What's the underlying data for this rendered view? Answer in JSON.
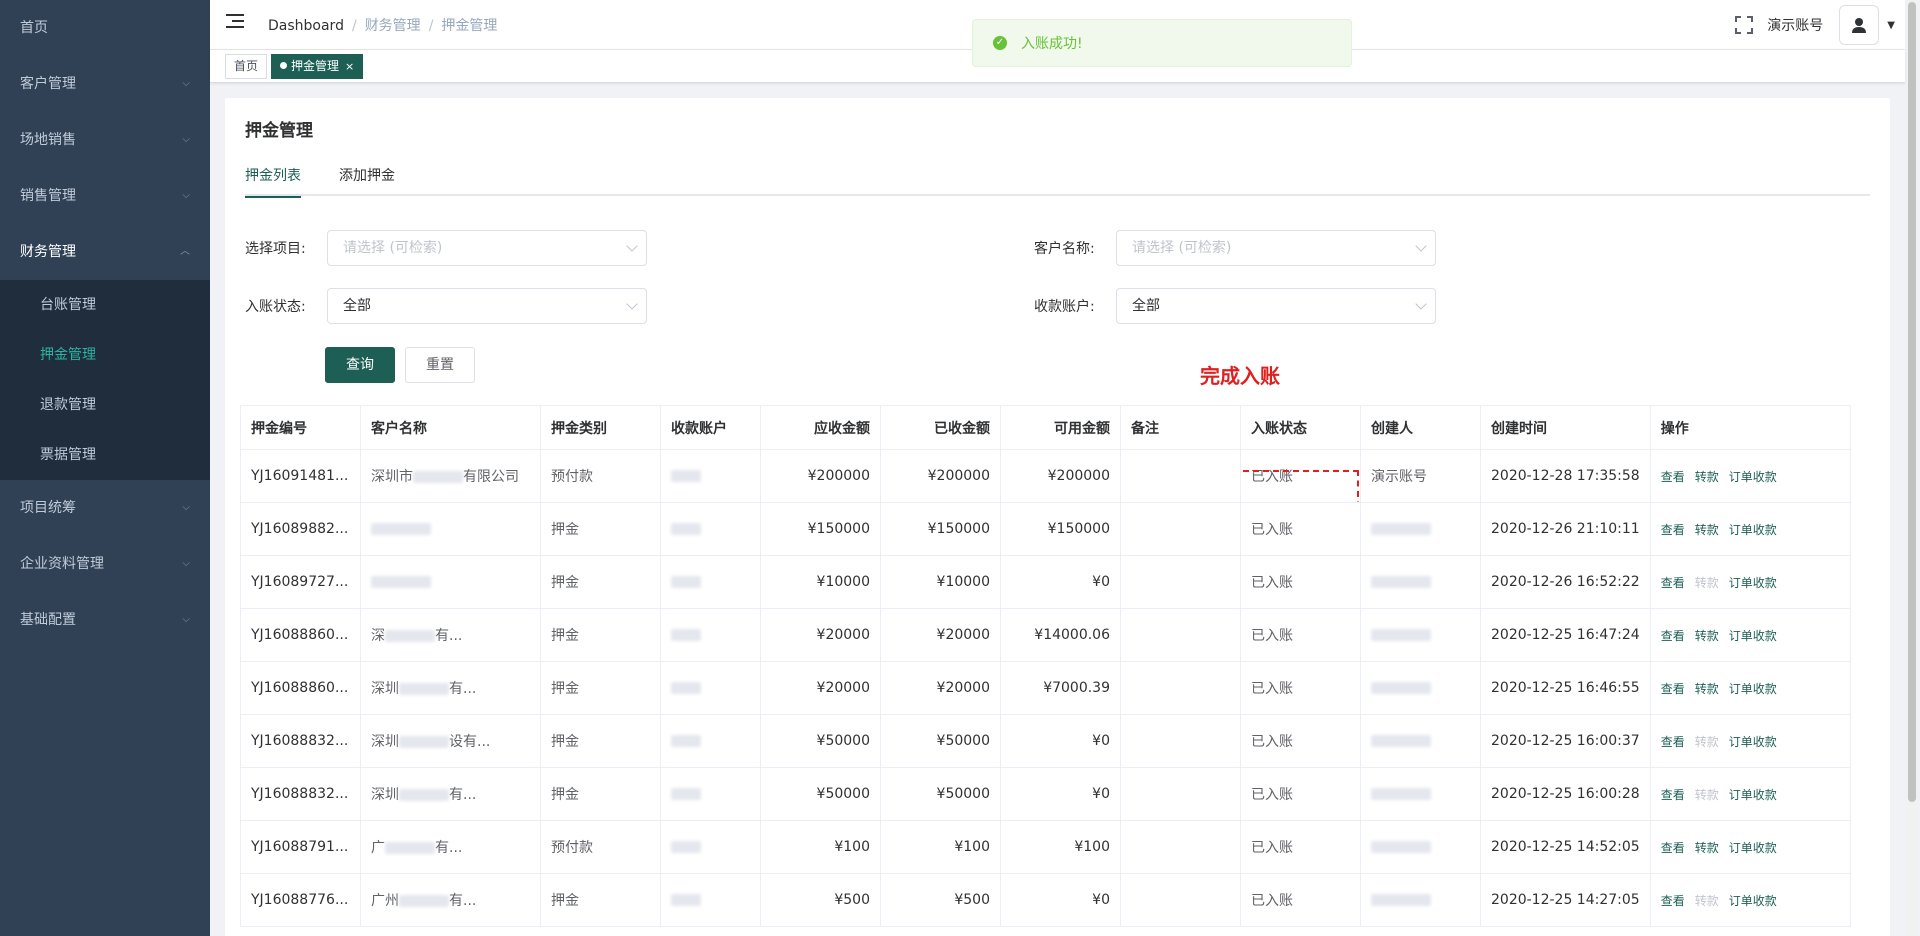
{
  "sidebar": {
    "items": [
      {
        "label": "首页",
        "has_arrow": false
      },
      {
        "label": "客户管理",
        "has_arrow": true
      },
      {
        "label": "场地销售",
        "has_arrow": true
      },
      {
        "label": "销售管理",
        "has_arrow": true
      },
      {
        "label": "财务管理",
        "has_arrow": true,
        "open": true
      },
      {
        "label": "项目统筹",
        "has_arrow": true
      },
      {
        "label": "企业资料管理",
        "has_arrow": true
      },
      {
        "label": "基础配置",
        "has_arrow": true
      }
    ],
    "finance_sub": [
      "台账管理",
      "押金管理",
      "退款管理",
      "票据管理"
    ]
  },
  "navbar": {
    "breadcrumb": [
      "Dashboard",
      "财务管理",
      "押金管理"
    ],
    "account_name": "演示账号"
  },
  "tags": [
    "首页",
    "押金管理"
  ],
  "toast": {
    "text": "入账成功!"
  },
  "page": {
    "title": "押金管理",
    "tabs": [
      "押金列表",
      "添加押金"
    ],
    "filters": {
      "project_label": "选择项目:",
      "project_placeholder": "请选择 (可检索)",
      "customer_label": "客户名称:",
      "customer_placeholder": "请选择 (可检索)",
      "status_label": "入账状态:",
      "status_value": "全部",
      "account_label": "收款账户:",
      "account_value": "全部"
    },
    "buttons": {
      "query": "查询",
      "reset": "重置"
    },
    "annotation": "完成入账"
  },
  "table": {
    "headers": [
      "押金编号",
      "客户名称",
      "押金类别",
      "收款账户",
      "应收金额",
      "已收金额",
      "可用金额",
      "备注",
      "入账状态",
      "创建人",
      "创建时间",
      "操作"
    ],
    "ops": [
      "查看",
      "转款",
      "订单收款"
    ],
    "rows": [
      {
        "code": "YJ16091481...",
        "customer": "深圳市",
        "customer_suffix": "有限公司",
        "category": "预付款",
        "due": "¥200000",
        "received": "¥200000",
        "available": "¥200000",
        "status": "已入账",
        "creator": "演示账号",
        "time": "2020-12-28 17:35:58",
        "transfer_enabled": true
      },
      {
        "code": "YJ16089882...",
        "customer": "",
        "customer_suffix": "",
        "category": "押金",
        "due": "¥150000",
        "received": "¥150000",
        "available": "¥150000",
        "status": "已入账",
        "creator": "",
        "time": "2020-12-26 21:10:11",
        "transfer_enabled": true
      },
      {
        "code": "YJ16089727...",
        "customer": "",
        "customer_suffix": "",
        "category": "押金",
        "due": "¥10000",
        "received": "¥10000",
        "available": "¥0",
        "status": "已入账",
        "creator": "",
        "time": "2020-12-26 16:52:22",
        "transfer_enabled": false
      },
      {
        "code": "YJ16088860...",
        "customer": "深",
        "customer_suffix": "有...",
        "category": "押金",
        "due": "¥20000",
        "received": "¥20000",
        "available": "¥14000.06",
        "status": "已入账",
        "creator": "",
        "time": "2020-12-25 16:47:24",
        "transfer_enabled": true
      },
      {
        "code": "YJ16088860...",
        "customer": "深圳",
        "customer_suffix": "有...",
        "category": "押金",
        "due": "¥20000",
        "received": "¥20000",
        "available": "¥7000.39",
        "status": "已入账",
        "creator": "",
        "time": "2020-12-25 16:46:55",
        "transfer_enabled": true
      },
      {
        "code": "YJ16088832...",
        "customer": "深圳",
        "customer_suffix": "设有...",
        "category": "押金",
        "due": "¥50000",
        "received": "¥50000",
        "available": "¥0",
        "status": "已入账",
        "creator": "",
        "time": "2020-12-25 16:00:37",
        "transfer_enabled": false
      },
      {
        "code": "YJ16088832...",
        "customer": "深圳",
        "customer_suffix": "有...",
        "category": "押金",
        "due": "¥50000",
        "received": "¥50000",
        "available": "¥0",
        "status": "已入账",
        "creator": "",
        "time": "2020-12-25 16:00:28",
        "transfer_enabled": false
      },
      {
        "code": "YJ16088791...",
        "customer": "广",
        "customer_suffix": "有...",
        "category": "预付款",
        "due": "¥100",
        "received": "¥100",
        "available": "¥100",
        "status": "已入账",
        "creator": "",
        "time": "2020-12-25 14:52:05",
        "transfer_enabled": true
      },
      {
        "code": "YJ16088776...",
        "customer": "广州",
        "customer_suffix": "有...",
        "category": "押金",
        "due": "¥500",
        "received": "¥500",
        "available": "¥0",
        "status": "已入账",
        "creator": "",
        "time": "2020-12-25 14:27:05",
        "transfer_enabled": false
      }
    ]
  },
  "colors": {
    "primary": "#1d5f55",
    "sidebar_bg": "#304156",
    "active_menu": "#2bb5a0",
    "annotation": "#e02020",
    "success": "#67c23a"
  }
}
